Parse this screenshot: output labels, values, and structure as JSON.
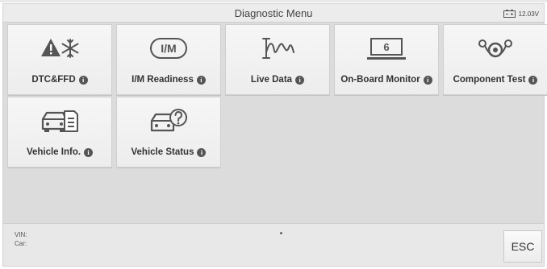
{
  "header": {
    "title": "Diagnostic Menu",
    "battery_voltage": "12.03V"
  },
  "tiles": [
    {
      "label": "DTC&FFD",
      "icon": "warning-snowflake-icon"
    },
    {
      "label": "I/M Readiness",
      "icon": "im-badge-icon"
    },
    {
      "label": "Live Data",
      "icon": "live-data-wave-icon"
    },
    {
      "label": "On-Board Monitor",
      "icon": "monitor-6-icon"
    },
    {
      "label": "Component Test",
      "icon": "component-gears-icon"
    },
    {
      "label": "Vehicle Info.",
      "icon": "vehicle-info-icon"
    },
    {
      "label": "Vehicle Status",
      "icon": "vehicle-status-icon"
    }
  ],
  "im_badge_text": "I/M",
  "monitor_number": "6",
  "info_glyph": "i",
  "footer": {
    "vin_label": "VIN:",
    "car_label": "Car:",
    "esc_label": "ESC"
  }
}
